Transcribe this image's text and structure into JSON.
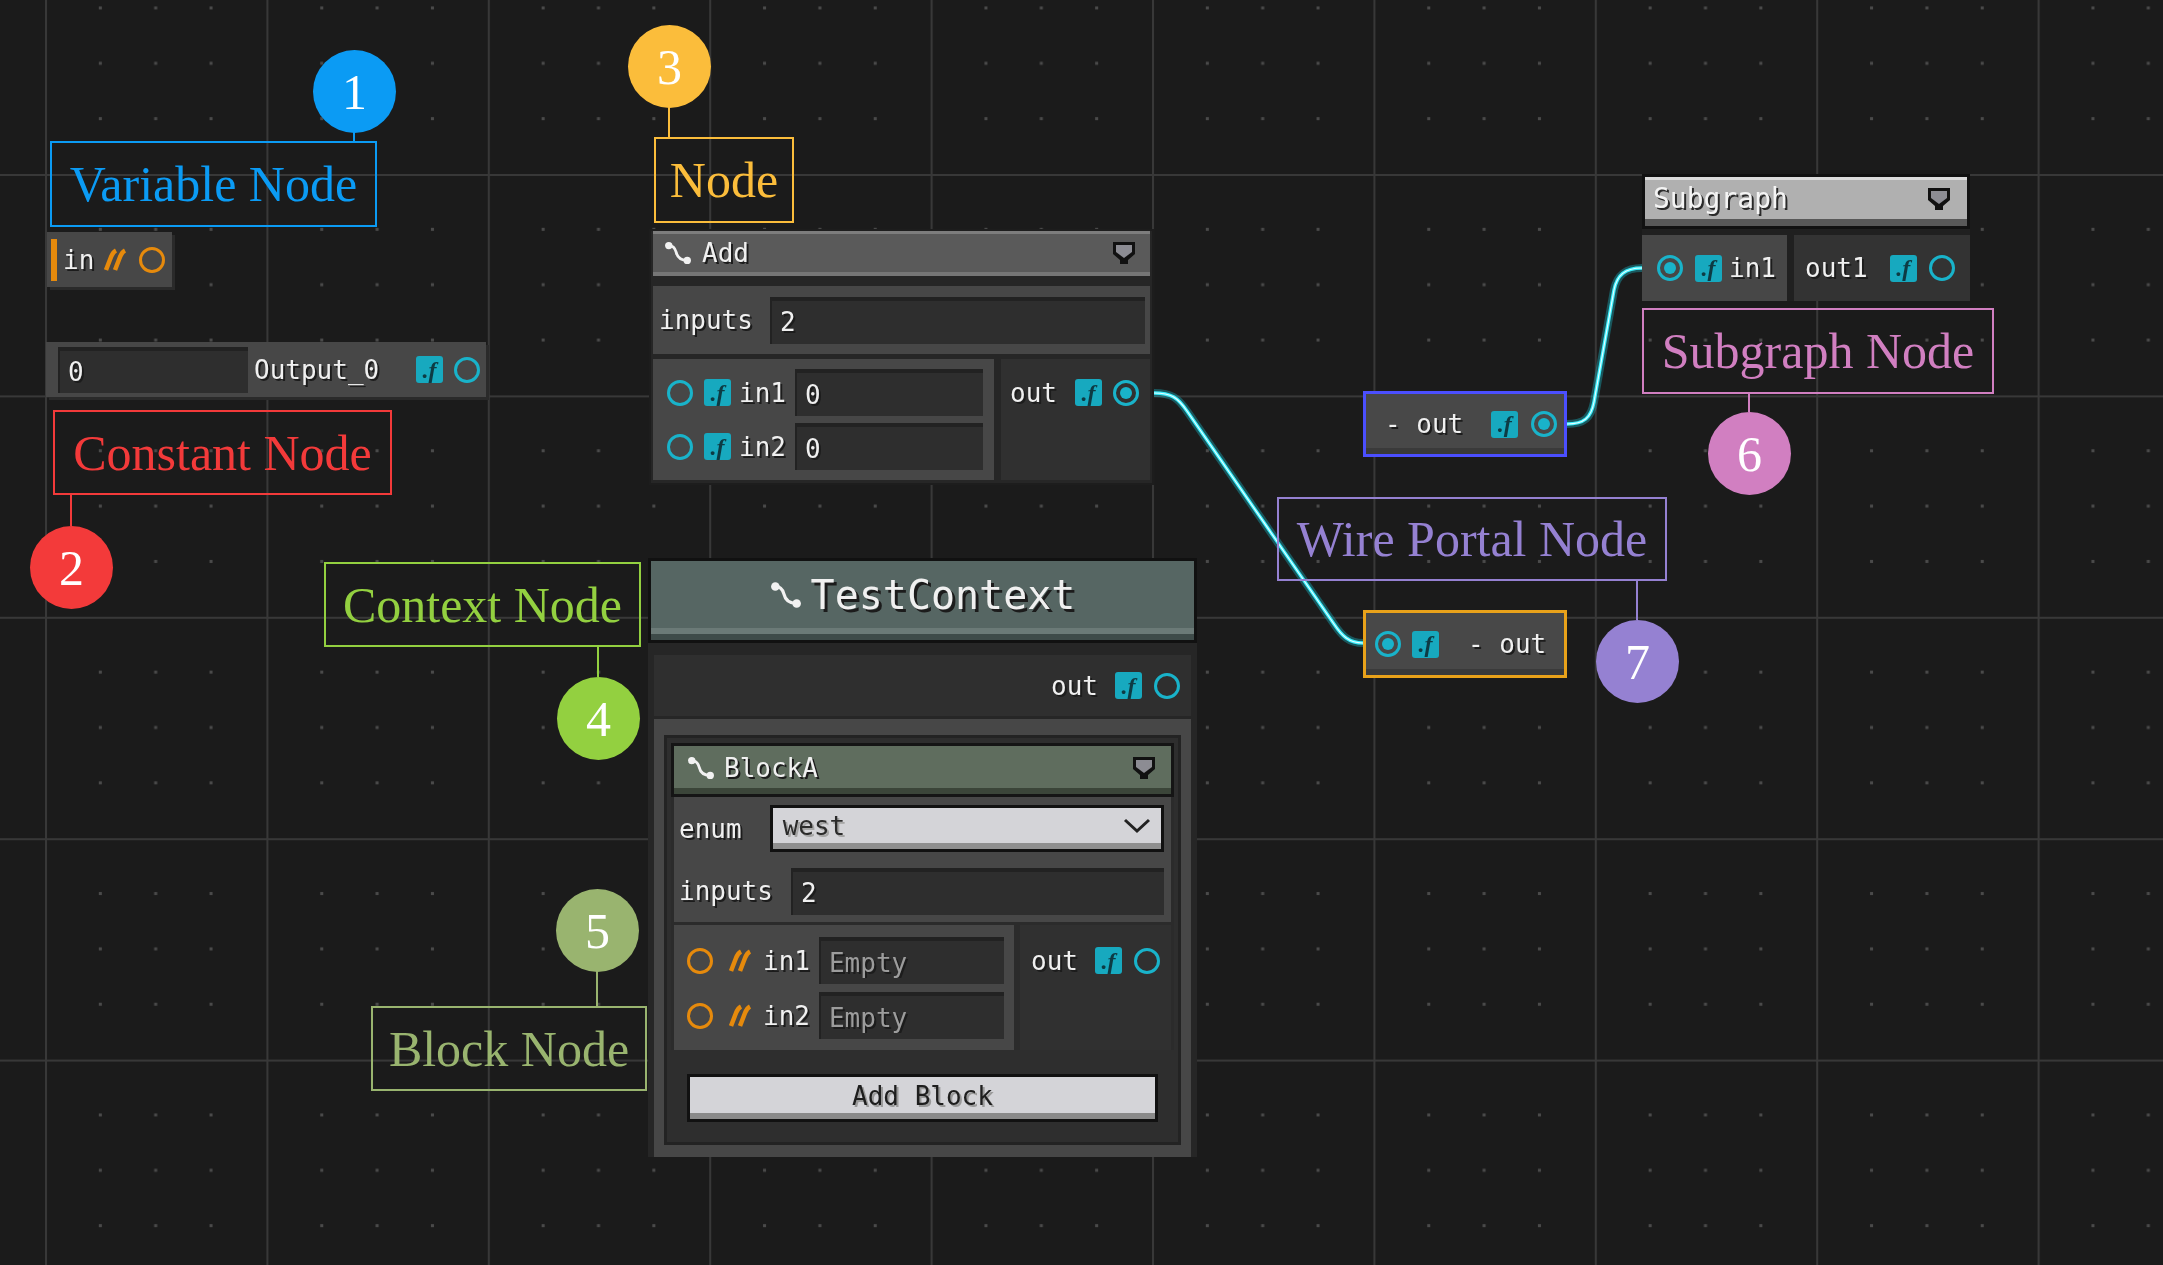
{
  "callouts": [
    {
      "number": "1",
      "label": "Variable Node",
      "color": "#0b9bf4"
    },
    {
      "number": "2",
      "label": "Constant Node",
      "color": "#f33a3a"
    },
    {
      "number": "3",
      "label": "Node",
      "color": "#fbbd3b"
    },
    {
      "number": "4",
      "label": "Context Node",
      "color": "#93d040"
    },
    {
      "number": "5",
      "label": "Block Node",
      "color": "#99b46f"
    },
    {
      "number": "6",
      "label": "Subgraph Node",
      "color": "#d17fc1"
    },
    {
      "number": "7",
      "label": "Wire Portal Node",
      "color": "#9581d2"
    }
  ],
  "variable_node": {
    "port": {
      "name": "in",
      "kind": "string",
      "connected": false
    }
  },
  "constant_node": {
    "value": "0",
    "port": {
      "name": "Output_0",
      "kind": "float",
      "badge": ".f",
      "connected": false
    }
  },
  "add_node": {
    "title": "Add",
    "fields": [
      {
        "kind": "number",
        "label": "inputs",
        "value": "2"
      }
    ],
    "inputs": [
      {
        "name": "in1",
        "kind": "float",
        "badge": ".f",
        "connected": false,
        "value": "0"
      },
      {
        "name": "in2",
        "kind": "float",
        "badge": ".f",
        "connected": false,
        "value": "0"
      }
    ],
    "outputs": [
      {
        "name": "out",
        "kind": "float",
        "badge": ".f",
        "connected": true
      }
    ]
  },
  "subgraph_node": {
    "title": "Subgraph",
    "inputs": [
      {
        "name": "in1",
        "kind": "float",
        "badge": ".f",
        "connected": true
      }
    ],
    "outputs": [
      {
        "name": "out1",
        "kind": "float",
        "badge": ".f",
        "connected": false
      }
    ]
  },
  "wire_portals": [
    {
      "kind": "output",
      "color": "#4b4fff",
      "label": "- out",
      "port": {
        "kind": "float",
        "badge": ".f",
        "connected": true
      }
    },
    {
      "kind": "input",
      "color": "#e9a21a",
      "label": "- out",
      "port": {
        "kind": "float",
        "badge": ".f",
        "connected": true
      }
    }
  ],
  "context_node": {
    "title": "TestContext",
    "outputs": [
      {
        "name": "out",
        "kind": "float",
        "badge": ".f",
        "connected": false
      }
    ],
    "block": {
      "title": "BlockA",
      "fields": [
        {
          "kind": "dropdown",
          "label": "enum",
          "value": "west"
        },
        {
          "kind": "number",
          "label": "inputs",
          "value": "2"
        }
      ],
      "inputs": [
        {
          "name": "in1",
          "kind": "string",
          "connected": false,
          "placeholder": "Empty"
        },
        {
          "name": "in2",
          "kind": "string",
          "connected": false,
          "placeholder": "Empty"
        }
      ],
      "outputs": [
        {
          "name": "out",
          "kind": "float",
          "badge": ".f",
          "connected": false
        }
      ]
    },
    "add_button": "Add Block"
  }
}
